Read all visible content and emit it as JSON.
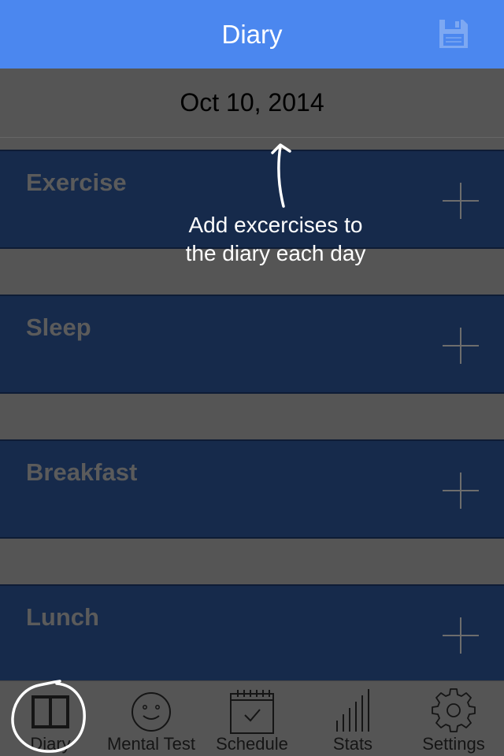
{
  "navbar": {
    "title": "Diary",
    "save_icon": "floppy-disk-icon"
  },
  "date": "Oct 10, 2014",
  "sections": [
    {
      "title": "Exercise",
      "add_icon": "plus-icon"
    },
    {
      "title": "Sleep",
      "add_icon": "plus-icon"
    },
    {
      "title": "Breakfast",
      "add_icon": "plus-icon"
    },
    {
      "title": "Lunch",
      "add_icon": "plus-icon"
    }
  ],
  "hint": {
    "line1": "Add excercises to",
    "line2": "the diary each day"
  },
  "tabs": [
    {
      "label": "Diary",
      "icon": "open-book-icon",
      "selected": true
    },
    {
      "label": "Mental Test",
      "icon": "smiley-face-icon"
    },
    {
      "label": "Schedule",
      "icon": "calendar-check-icon"
    },
    {
      "label": "Stats",
      "icon": "bar-chart-icon"
    },
    {
      "label": "Settings",
      "icon": "gear-icon"
    }
  ],
  "colors": {
    "navbar": "#4b87ef",
    "section": "#162a4b",
    "background": "#555555"
  }
}
